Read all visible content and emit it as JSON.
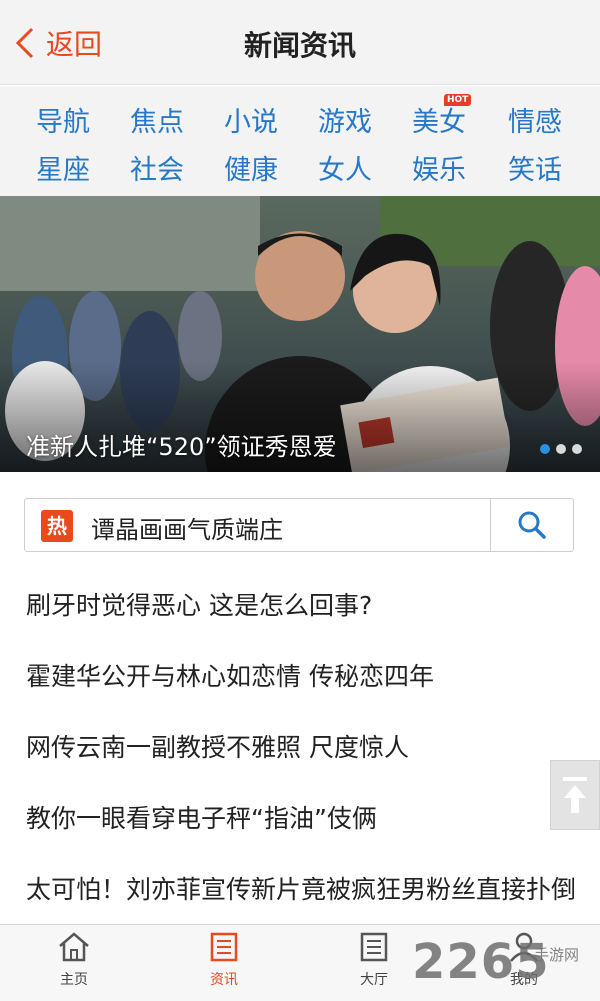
{
  "header": {
    "back_label": "返回",
    "title": "新闻资讯"
  },
  "categories": [
    {
      "label": "导航"
    },
    {
      "label": "焦点"
    },
    {
      "label": "小说"
    },
    {
      "label": "游戏"
    },
    {
      "label": "美女",
      "badge": "HOT"
    },
    {
      "label": "情感"
    },
    {
      "label": "星座"
    },
    {
      "label": "社会"
    },
    {
      "label": "健康"
    },
    {
      "label": "女人"
    },
    {
      "label": "娱乐"
    },
    {
      "label": "笑话"
    }
  ],
  "banner": {
    "caption": "准新人扎堆“520”领证秀恩爱",
    "slide_count": 3,
    "active_slide": 1
  },
  "search": {
    "hot_badge": "热",
    "query": "谭晶画画气质端庄",
    "button_icon": "search-icon"
  },
  "news": [
    "刷牙时觉得恶心 这是怎么回事?",
    "霍建华公开与林心如恋情 传秘恋四年",
    "网传云南一副教授不雅照 尺度惊人",
    "教你一眼看穿电子秤“指油”伎俩",
    "太可怕！刘亦菲宣传新片竟被疯狂男粉丝直接扑倒"
  ],
  "tabbar": [
    {
      "label": "主页",
      "icon": "home-icon"
    },
    {
      "label": "资讯",
      "icon": "news-icon",
      "active": true
    },
    {
      "label": "大厅",
      "icon": "list-icon"
    },
    {
      "label": "我的",
      "icon": "user-icon"
    }
  ],
  "watermark": {
    "number": "2265",
    "text": "手游网"
  },
  "colors": {
    "accent": "#e8491d",
    "link_blue": "#2878c8",
    "header_bg": "#f3f3f3",
    "dot_active": "#2c8fe0"
  }
}
